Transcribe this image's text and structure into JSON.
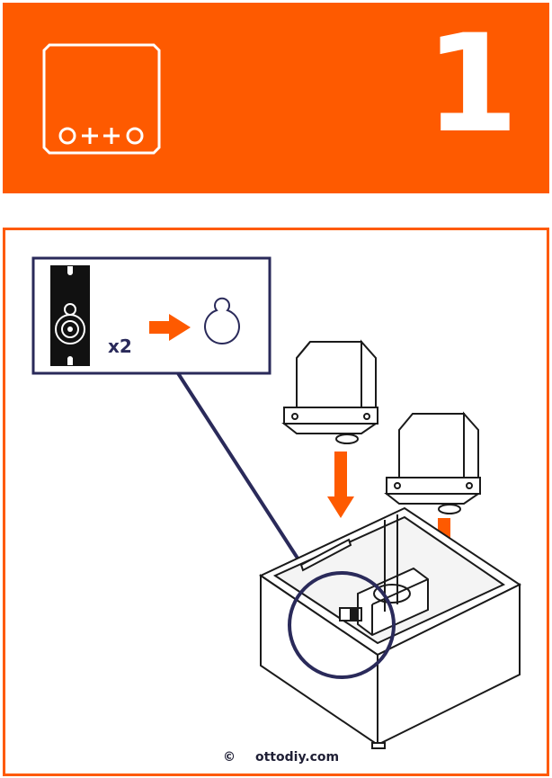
{
  "header": {
    "brand": "otto",
    "step_number": "1"
  },
  "callout": {
    "quantity": "x2"
  },
  "footer": {
    "copyright_symbol": "©",
    "site": "ottodiy.com"
  },
  "colors": {
    "accent": "#fe5a00",
    "navy": "#2a2a5a",
    "ink": "#1a1a1a",
    "white": "#ffffff"
  },
  "icons": [
    "otto-logo-icon",
    "arrow-right-icon",
    "arrow-down-icon",
    "servo-horn-icon",
    "keyhole-icon"
  ]
}
